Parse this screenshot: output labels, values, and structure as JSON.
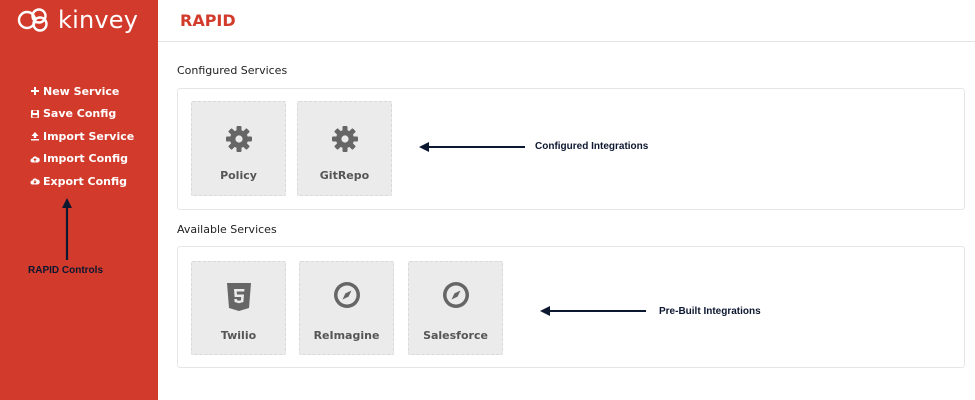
{
  "brand": {
    "name": "kinvey",
    "accent": "#d23a2b"
  },
  "sidebar": {
    "items": [
      {
        "label": "New Service",
        "icon": "plus-icon"
      },
      {
        "label": "Save Config",
        "icon": "floppy-disk-icon"
      },
      {
        "label": "Import Service",
        "icon": "upload-icon"
      },
      {
        "label": "Import Config",
        "icon": "cloud-upload-icon"
      },
      {
        "label": "Export Config",
        "icon": "cloud-download-icon"
      }
    ]
  },
  "header": {
    "title": "RAPID"
  },
  "configured": {
    "heading": "Configured Services",
    "cards": [
      {
        "label": "Policy",
        "icon": "gear-icon"
      },
      {
        "label": "GitRepo",
        "icon": "gear-icon"
      }
    ]
  },
  "available": {
    "heading": "Available Services",
    "cards": [
      {
        "label": "Twilio",
        "icon": "html5-icon"
      },
      {
        "label": "ReImagine",
        "icon": "compass-icon"
      },
      {
        "label": "Salesforce",
        "icon": "compass-icon"
      }
    ]
  },
  "annotations": {
    "controls": "RAPID Controls",
    "configured": "Configured Integrations",
    "prebuilt": "Pre-Built Integrations"
  }
}
